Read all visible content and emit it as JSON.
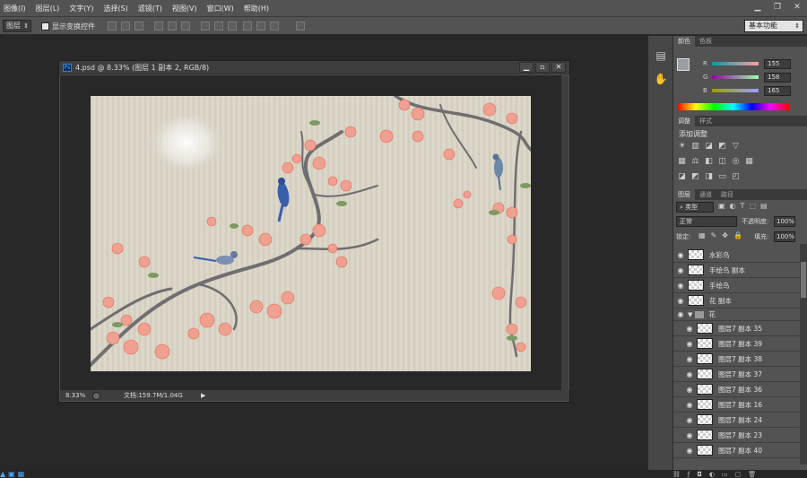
{
  "menu": {
    "items": [
      "图像(I)",
      "图层(L)",
      "文字(Y)",
      "选择(S)",
      "滤镜(T)",
      "视图(V)",
      "窗口(W)",
      "帮助(H)"
    ]
  },
  "options": {
    "layer_select": "图层",
    "show_transform": "显示变换控件",
    "workspace": "基本功能"
  },
  "document": {
    "title": "4.psd @ 8.33% (图层 1 副本 2, RGB/8)",
    "ps_badge": "Ps",
    "zoom": "8.33%",
    "doc_info": "文档:159.7M/1.04G"
  },
  "color_panel": {
    "tabs": [
      "颜色",
      "色板"
    ],
    "r_label": "R",
    "g_label": "G",
    "b_label": "B",
    "r": "155",
    "g": "158",
    "b": "165"
  },
  "adjust_panel": {
    "tabs": [
      "调整",
      "样式"
    ],
    "title": "添加调整"
  },
  "layers_panel": {
    "tabs": [
      "图层",
      "通道",
      "路径"
    ],
    "filter": "类型",
    "blend": "正常",
    "opacity_label": "不透明度:",
    "opacity": "100%",
    "lock_label": "锁定:",
    "fill_label": "填充:",
    "fill": "100%",
    "layers": [
      {
        "name": "水彩鸟"
      },
      {
        "name": "手绘鸟 副本"
      },
      {
        "name": "手绘鸟"
      },
      {
        "name": "花 副本"
      },
      {
        "name": "花"
      },
      {
        "name": "图层7 副本 35"
      },
      {
        "name": "图层7 副本 39"
      },
      {
        "name": "图层7 副本 38"
      },
      {
        "name": "图层7 副本 37"
      },
      {
        "name": "图层7 副本 36"
      },
      {
        "name": "图层7 副本 16"
      },
      {
        "name": "图层7 副本 24"
      },
      {
        "name": "图层7 副本 23"
      },
      {
        "name": "图层7 副本 40"
      }
    ]
  },
  "colors": {
    "ui_bg": "#535353",
    "canvas_bg": "#282828",
    "picture_bg": "#d9d4c6",
    "blossom": "#f0a090",
    "bird": "#3a5fa8"
  }
}
